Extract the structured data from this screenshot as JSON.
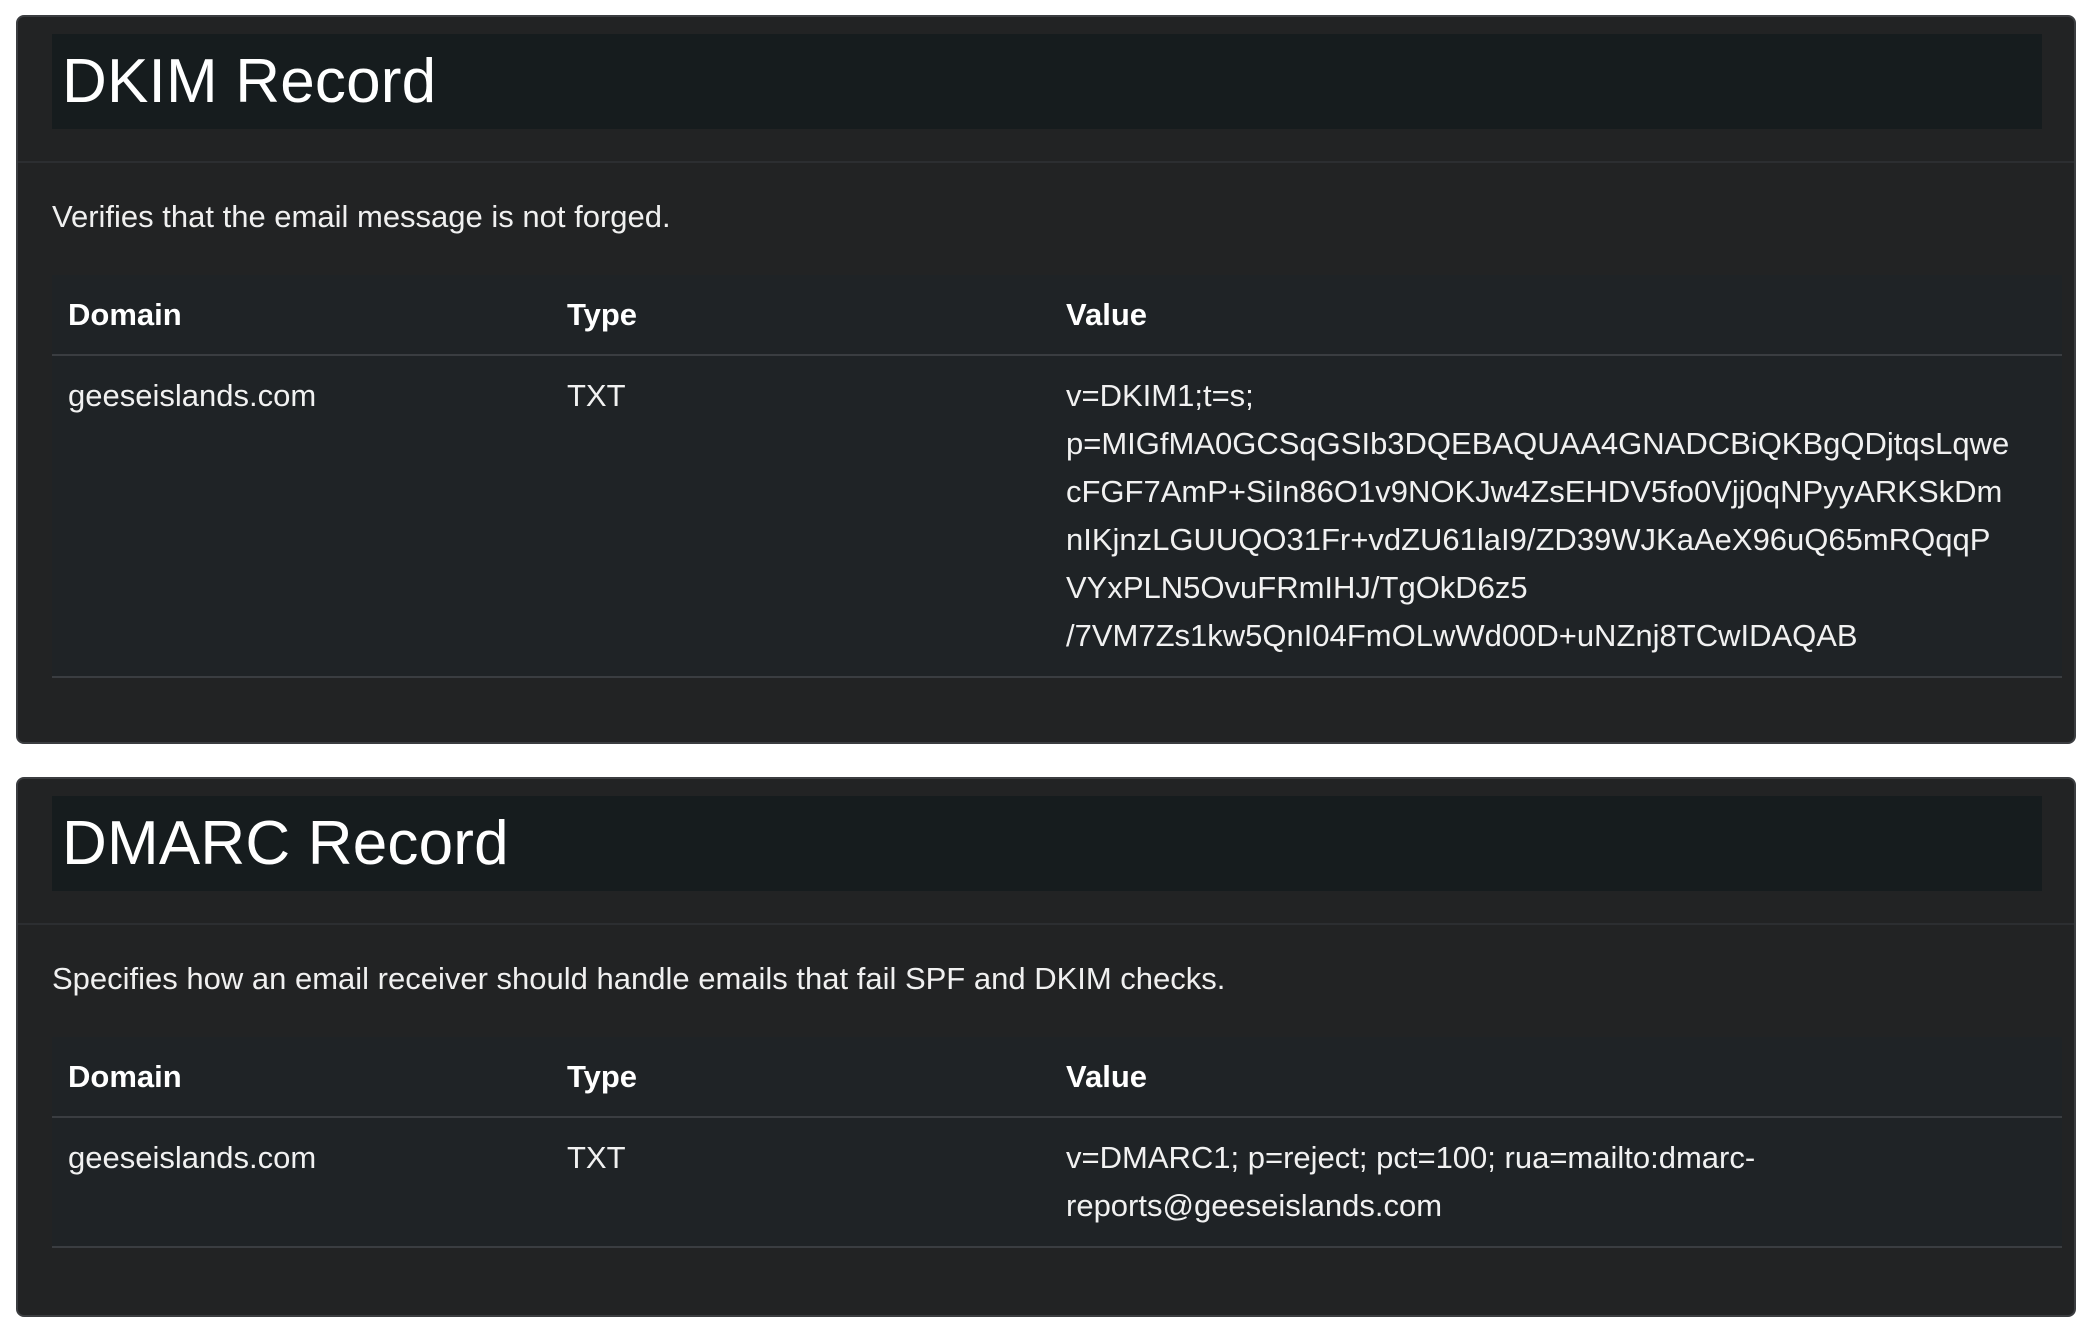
{
  "dkim": {
    "title": "DKIM Record",
    "description": "Verifies that the email message is not forged.",
    "headers": {
      "domain": "Domain",
      "type": "Type",
      "value": "Value"
    },
    "row": {
      "domain": "geeseislands.com",
      "type": "TXT",
      "value_lines": [
        "v=DKIM1;t=s;",
        "p=MIGfMA0GCSqGSIb3DQEBAQUAA4GNADCBiQKBgQDjtqsLqwe",
        "cFGF7AmP+SiIn86O1v9NOKJw4ZsEHDV5fo0Vjj0qNPyyARKSkDm",
        "nIKjnzLGUUQO31Fr+vdZU61laI9/ZD39WJKaAeX96uQ65mRQqqP",
        "VYxPLN5OvuFRmIHJ/TgOkD6z5",
        "/7VM7Zs1kw5QnI04FmOLwWd00D+uNZnj8TCwIDAQAB"
      ]
    }
  },
  "dmarc": {
    "title": "DMARC Record",
    "description": "Specifies how an email receiver should handle emails that fail SPF and DKIM checks.",
    "headers": {
      "domain": "Domain",
      "type": "Type",
      "value": "Value"
    },
    "row": {
      "domain": "geeseislands.com",
      "type": "TXT",
      "value_lines": [
        "v=DMARC1; p=reject; pct=100; rua=mailto:dmarc-",
        "reports@geeseislands.com"
      ]
    }
  },
  "colors": {
    "card_bg": "#222324",
    "title_band": "#161c1e",
    "table_bg": "#1f2326",
    "page_bg": "#ffffff"
  }
}
